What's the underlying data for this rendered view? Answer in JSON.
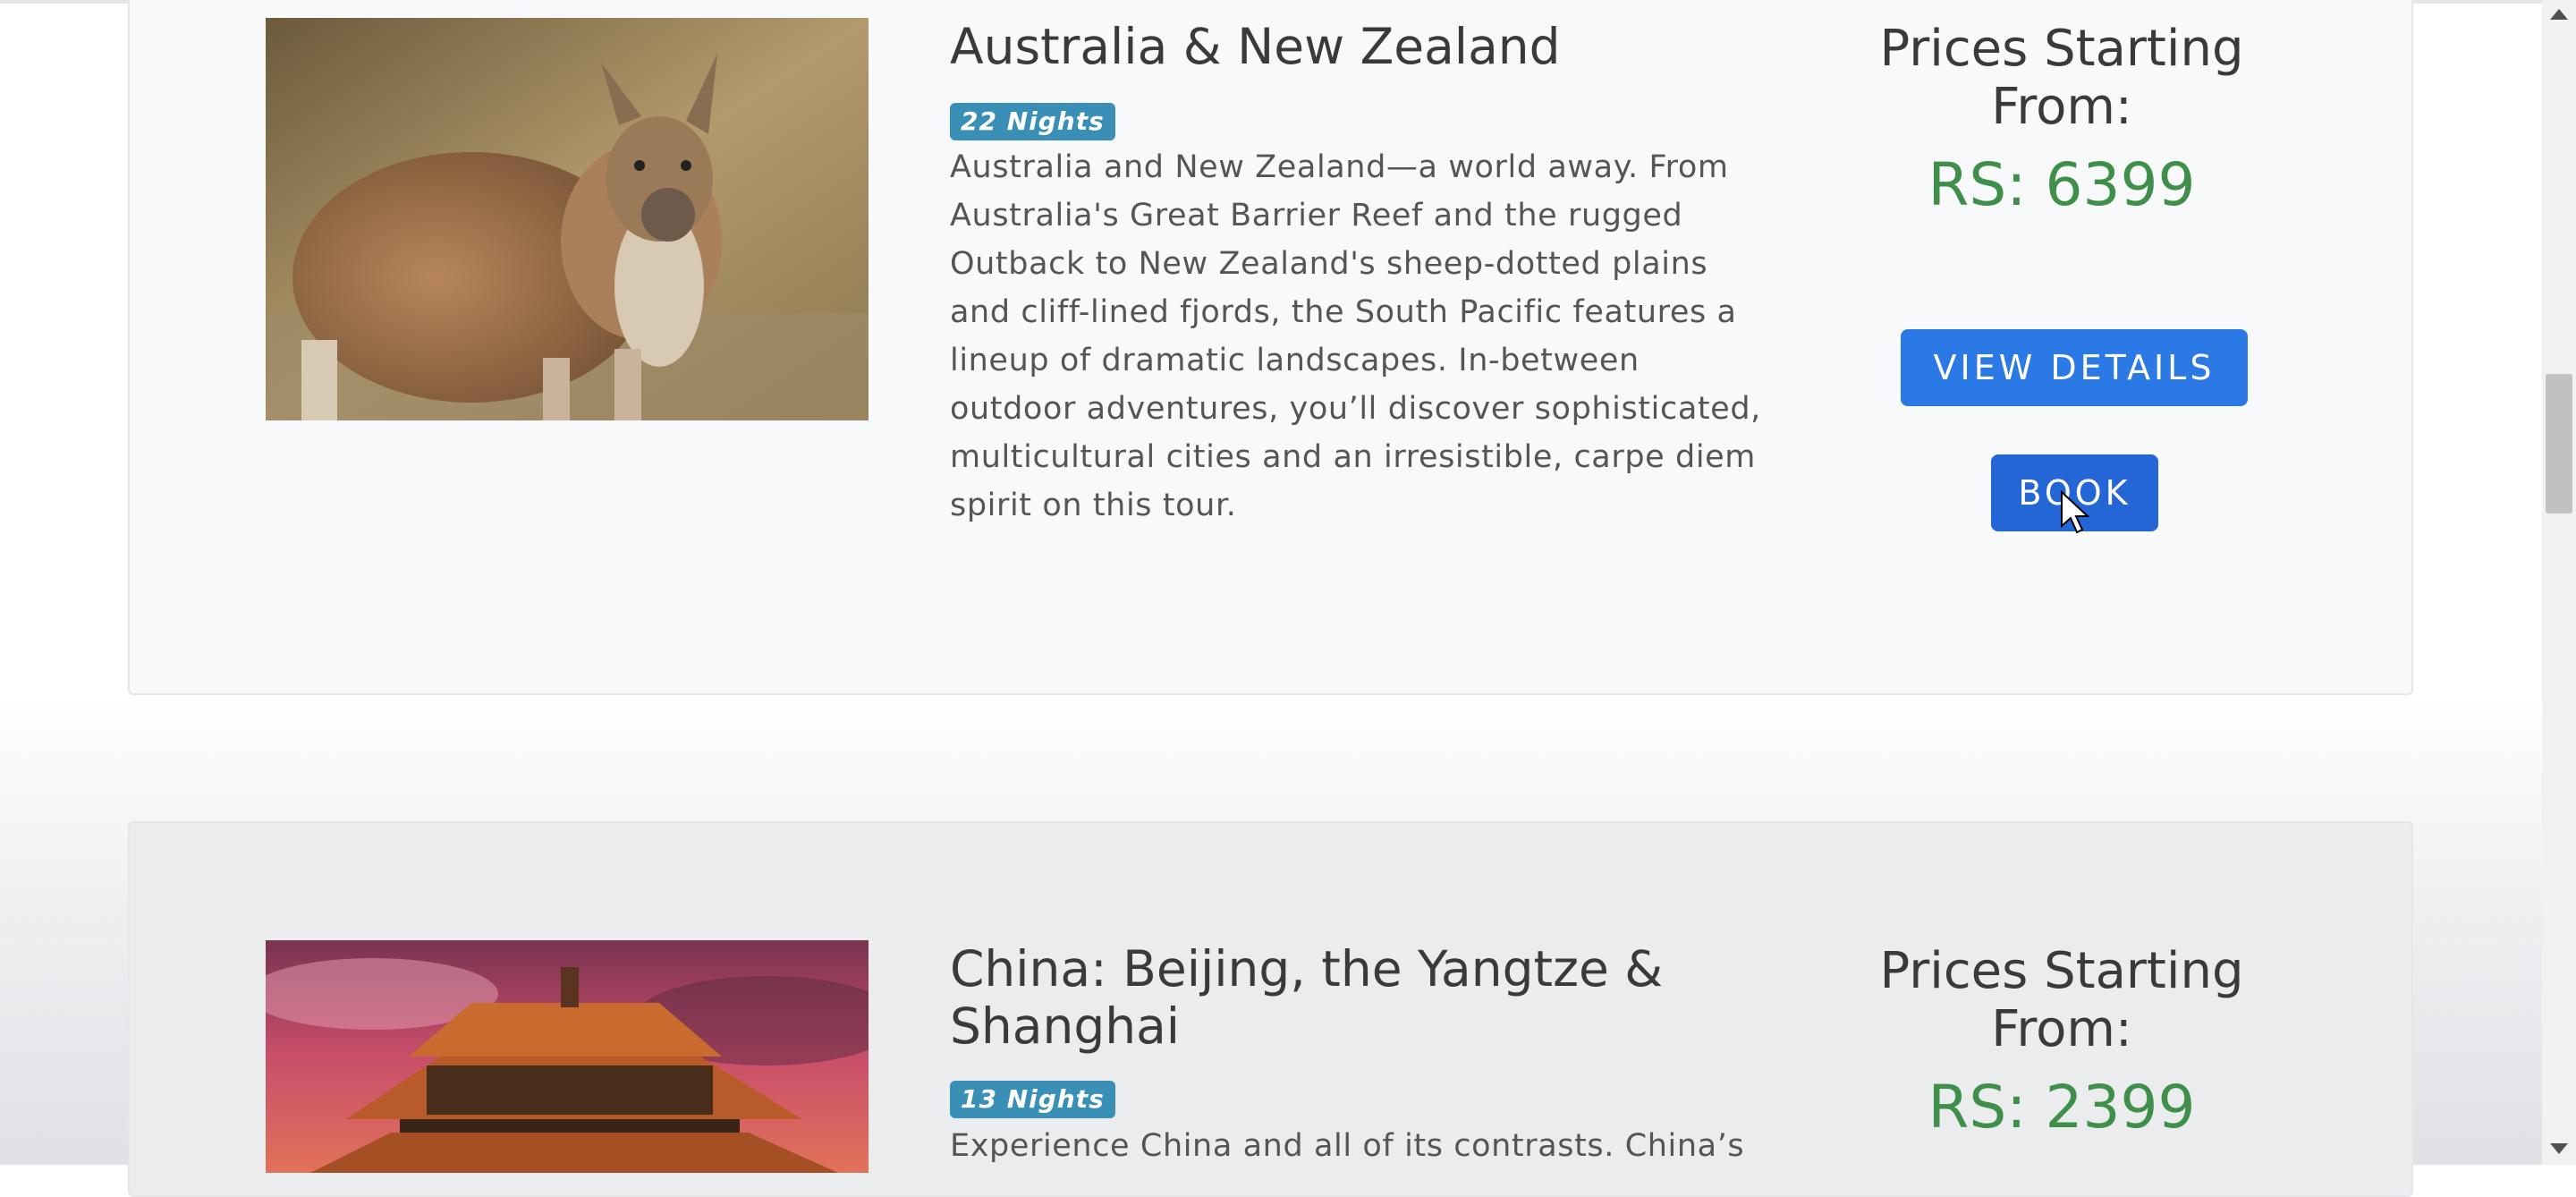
{
  "tours": [
    {
      "title": "Australia & New Zealand",
      "nights": "22 Nights",
      "description": "Australia and New Zealand—a world away. From Australia's Great Barrier Reef and the rugged Outback to New Zealand's sheep-dotted plains and cliff-lined fjords, the South Pacific features a lineup of dramatic landscapes. In-between outdoor adventures, you’ll discover sophisticated, multicultural cities and an irresistible, carpe diem spirit on this tour.",
      "price_heading": "Prices Starting From:",
      "price": "RS: 6399",
      "view_details_label": "VIEW DETAILS",
      "book_label": "BOOK"
    },
    {
      "title": "China: Beijing, the Yangtze & Shanghai",
      "nights": "13 Nights",
      "description": "Experience China and all of its contrasts. China’s",
      "price_heading": "Prices Starting From:",
      "price": "RS: 2399"
    }
  ],
  "colors": {
    "button": "#2a79e4",
    "price": "#3f8f4a",
    "badge": "#3a8fb7"
  }
}
